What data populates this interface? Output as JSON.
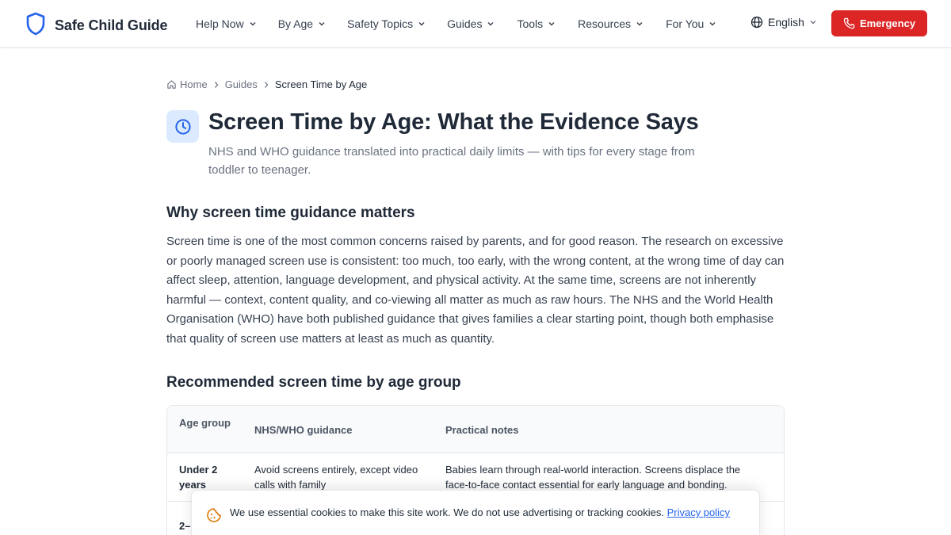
{
  "header": {
    "brand": "Safe Child Guide",
    "nav": [
      "Help Now",
      "By Age",
      "Safety Topics",
      "Guides",
      "Tools",
      "Resources",
      "For You"
    ],
    "language": "English",
    "emergency_label": "Emergency"
  },
  "breadcrumb": {
    "home": "Home",
    "guides": "Guides",
    "current": "Screen Time by Age"
  },
  "page": {
    "title": "Screen Time by Age: What the Evidence Says",
    "subtitle": "NHS and WHO guidance translated into practical daily limits — with tips for every stage from toddler to teenager."
  },
  "section1": {
    "heading": "Why screen time guidance matters",
    "body": "Screen time is one of the most common concerns raised by parents, and for good reason. The research on excessive or poorly managed screen use is consistent: too much, too early, with the wrong content, at the wrong time of day can affect sleep, attention, language development, and physical activity. At the same time, screens are not inherently harmful — context, content quality, and co-viewing all matter as much as raw hours. The NHS and the World Health Organisation (WHO) have both published guidance that gives families a clear starting point, though both emphasise that quality of screen use matters at least as much as quantity."
  },
  "section2": {
    "heading": "Recommended screen time by age group"
  },
  "table": {
    "headers": [
      "Age group",
      "NHS/WHO guidance",
      "Practical notes"
    ],
    "rows": [
      {
        "age": "Under 2 years",
        "guidance": "Avoid screens entirely, except video calls with family",
        "notes": "Babies learn through real-world interaction. Screens displace the face-to-face contact essential for early language and bonding."
      },
      {
        "age": "2–",
        "guidance": "",
        "notes": ""
      }
    ]
  },
  "cookie": {
    "text": "We use essential cookies to make this site work. We do not use advertising or tracking cookies.",
    "link": "Privacy policy"
  },
  "colors": {
    "brand_blue": "#2563eb",
    "emergency_red": "#dc2626",
    "icon_bg": "#dbeafe"
  },
  "icons": {
    "brand": "shield-icon",
    "language": "globe-icon",
    "emergency": "phone-icon",
    "breadcrumb_home": "home-icon",
    "title": "clock-icon",
    "cookie": "cookie-icon"
  }
}
